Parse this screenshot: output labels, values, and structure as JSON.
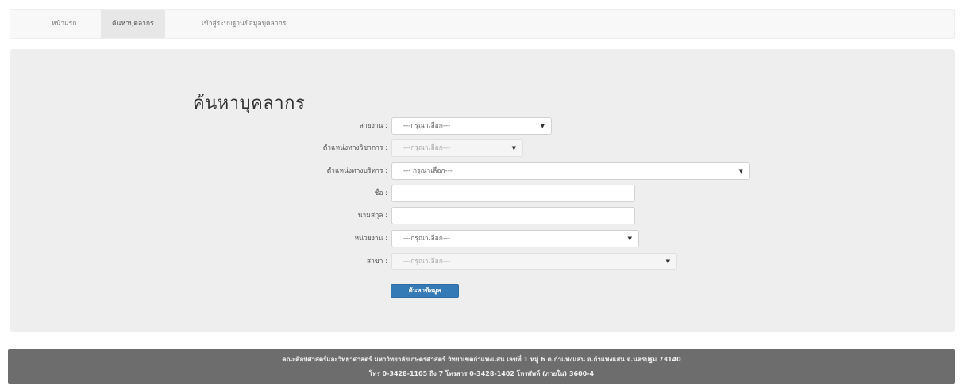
{
  "nav": {
    "items": [
      {
        "label": "หน้าแรก",
        "active": false
      },
      {
        "label": "ค้นหาบุคลากร",
        "active": true
      },
      {
        "label": "เข้าสู่ระบบฐานข้อมูลบุคลากร",
        "active": false
      }
    ]
  },
  "form": {
    "title": "ค้นหาบุคลากร",
    "fields": [
      {
        "label": "สายงาน :",
        "value": "---กรุณาเลือก---",
        "type": "select",
        "disabled": false
      },
      {
        "label": "ตำแหน่งทางวิชาการ :",
        "value": "---กรุณาเลือก---",
        "type": "select",
        "disabled": true
      },
      {
        "label": "ตำแหน่งทางบริหาร :",
        "value": "--- กรุณาเลือก---",
        "type": "select",
        "disabled": false
      },
      {
        "label": "ชื่อ :",
        "value": "",
        "type": "text",
        "disabled": false
      },
      {
        "label": "นามสกุล :",
        "value": "",
        "type": "text",
        "disabled": false
      },
      {
        "label": "หน่วยงาน :",
        "value": "---กรุณาเลือก---",
        "type": "select",
        "disabled": false
      },
      {
        "label": "สาขา :",
        "value": "---กรุณาเลือก---",
        "type": "select",
        "disabled": true
      }
    ],
    "submit_label": "ค้นหาข้อมูล"
  },
  "footer": {
    "line1": "คณะศิลปศาสตร์และวิทยาศาสตร์ มหาวิทยาลัยเกษตรศาสตร์ วิทยาเขตกำแพงแสน เลขที่ 1 หมู่ 6 ต.กำแพงแสน อ.กำแพงแสน จ.นครปฐม 73140",
    "line2": "โทร 0-3428-1105 ถึง 7 โทรสาร 0-3428-1402 โทรศัพท์ (ภายใน) 3600-4"
  },
  "colors": {
    "primary_button": "#337ab7",
    "footer_bg": "#6d6d6d",
    "panel_bg": "#eeeeee"
  }
}
